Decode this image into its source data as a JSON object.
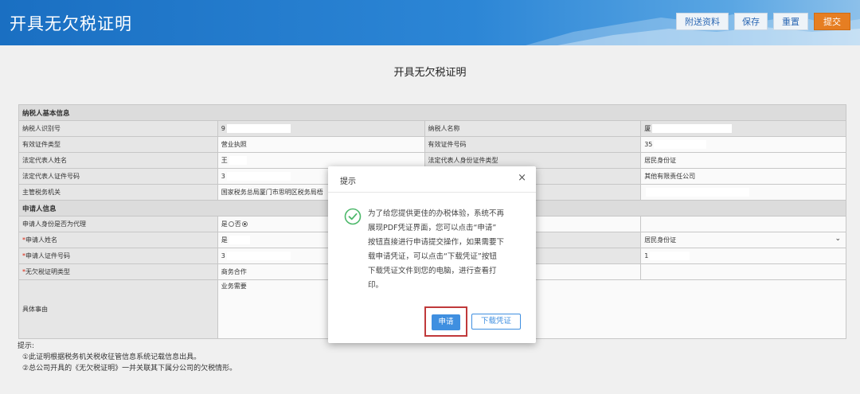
{
  "header": {
    "title": "开具无欠税证明",
    "buttons": [
      {
        "label": "附送资料"
      },
      {
        "label": "保存"
      },
      {
        "label": "重置"
      },
      {
        "label": "提交"
      }
    ]
  },
  "main": {
    "title": "开具无欠税证明",
    "sections": {
      "taxpayer": "纳税人基本信息",
      "applicant": "申请人信息"
    },
    "rows": {
      "tax_id_label": "纳税人识别号",
      "tax_id_value": "9",
      "taxpayer_name_label": "纳税人名称",
      "taxpayer_name_value": "厦",
      "cert_type_label": "有效证件类型",
      "cert_type_value": "营业执照",
      "cert_no_label": "有效证件号码",
      "cert_no_value": "35",
      "legal_rep_name_label": "法定代表人姓名",
      "legal_rep_name_value": "王",
      "legal_rep_id_type_label": "法定代表人身份证件类型",
      "legal_rep_id_type_value": "居民身份证",
      "legal_rep_id_no_label": "法定代表人证件号码",
      "legal_rep_id_no_value": "3",
      "company_type_value": "其他有限责任公司",
      "tax_authority_label": "主管税务机关",
      "tax_authority_value": "国家税务总局厦门市思明区税务局梧",
      "is_agent_label": "申请人身份是否为代理",
      "is_agent_yes": "是",
      "is_agent_no": "否",
      "applicant_name_label": "申请人姓名",
      "applicant_name_value": "是",
      "applicant_id_type_value": "居民身份证",
      "applicant_id_no_label": "申请人证件号码",
      "applicant_id_no_value": "3",
      "applicant_id_no_value2": "1",
      "cert_kind_label": "无欠税证明类型",
      "cert_kind_value": "商务合作",
      "reason_label": "具体事由",
      "reason_value": "业务需要"
    },
    "required_mark": "*",
    "notes": {
      "title": "提示:",
      "line1": "①此证明根据税务机关税收征管信息系统记载信息出具。",
      "line2": "②总公司开具的《无欠税证明》一并关联其下属分公司的欠税情形。"
    }
  },
  "dialog": {
    "title": "提示",
    "close": "×",
    "message_lines": [
      "为了给您提供更佳的办税体验，系统不再",
      "展现PDF凭证界面，您可以点击“申请”",
      "按钮直接进行申请提交操作，如果需要下",
      "载申请凭证，可以点击“下载凭证”按钮",
      "下载凭证文件到您的电脑，进行查看打",
      "印。"
    ],
    "apply_label": "申请",
    "download_label": "下载凭证",
    "icon": "success-check-icon",
    "accent": "#3f8fe0",
    "highlight": "#c0393a"
  }
}
